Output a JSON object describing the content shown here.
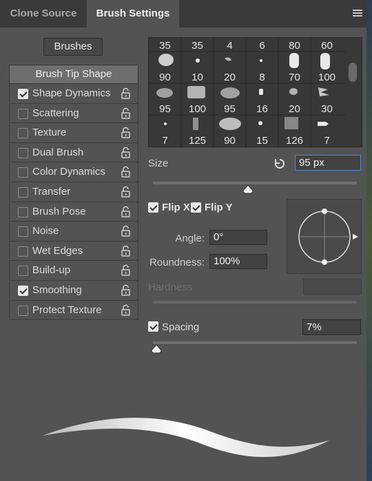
{
  "tabs": [
    {
      "label": "Clone Source",
      "active": false
    },
    {
      "label": "Brush Settings",
      "active": true
    }
  ],
  "brushes_button": "Brushes",
  "tip_shape_label": "Brush Tip Shape",
  "options": [
    {
      "label": "Shape Dynamics",
      "checked": true
    },
    {
      "label": "Scattering",
      "checked": false
    },
    {
      "label": "Texture",
      "checked": false
    },
    {
      "label": "Dual Brush",
      "checked": false
    },
    {
      "label": "Color Dynamics",
      "checked": false
    },
    {
      "label": "Transfer",
      "checked": false
    },
    {
      "label": "Brush Pose",
      "checked": false
    },
    {
      "label": "Noise",
      "checked": false
    },
    {
      "label": "Wet Edges",
      "checked": false
    },
    {
      "label": "Build-up",
      "checked": false
    },
    {
      "label": "Smoothing",
      "checked": true
    },
    {
      "label": "Protect Texture",
      "checked": false
    }
  ],
  "brush_grid": {
    "top_sizes": [
      "35",
      "35",
      "4",
      "6",
      "80",
      "60"
    ],
    "row2_sizes": [
      "90",
      "10",
      "20",
      "8",
      "70",
      "100"
    ],
    "row3_sizes": [
      "95",
      "100",
      "95",
      "16",
      "20",
      "30"
    ],
    "row4_sizes": [
      "7",
      "125",
      "90",
      "15",
      "126",
      "7"
    ]
  },
  "size": {
    "label": "Size",
    "value": "95 px",
    "slider_fraction": 0.47
  },
  "flip_x": {
    "label": "Flip X",
    "checked": true
  },
  "flip_y": {
    "label": "Flip Y",
    "checked": true
  },
  "angle": {
    "label": "Angle:",
    "value": "0°"
  },
  "roundness": {
    "label": "Roundness:",
    "value": "100%"
  },
  "hardness": {
    "label": "Hardness",
    "value": ""
  },
  "spacing": {
    "label": "Spacing",
    "checked": true,
    "value": "7%",
    "slider_fraction": 0.02
  },
  "colors": {
    "panel": "#535353",
    "tabbar": "#3a3a3a",
    "accent": "#4d8ad6"
  }
}
